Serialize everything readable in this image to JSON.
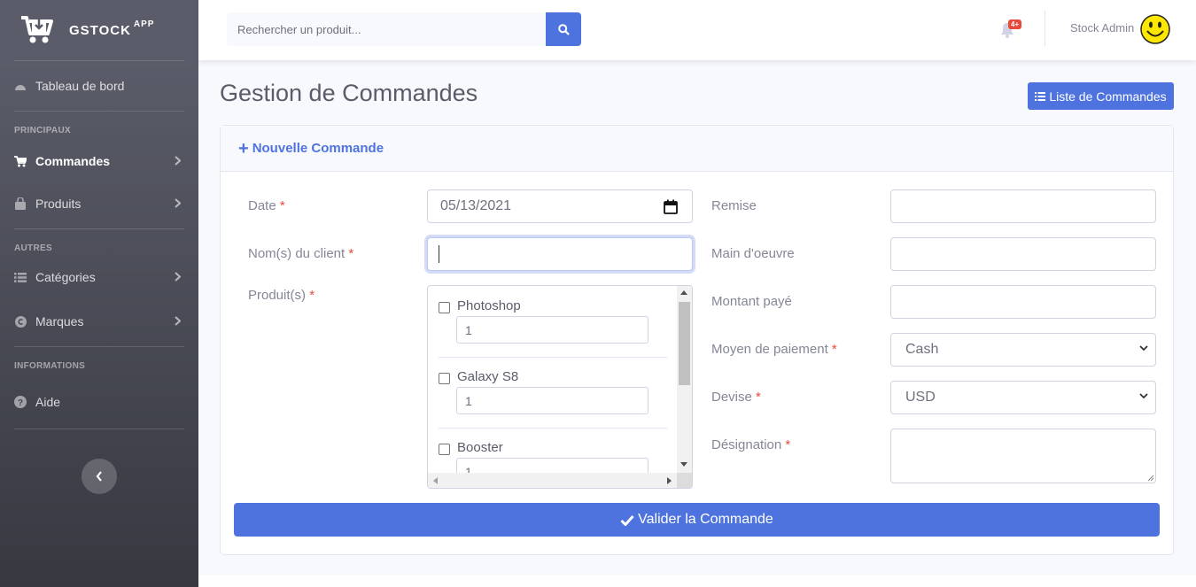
{
  "brand": {
    "name": "GSTOCK",
    "sup": "APP"
  },
  "sidebar": {
    "dashboard": "Tableau de bord",
    "heading_main": "PRINCIPAUX",
    "commandes": "Commandes",
    "produits": "Produits",
    "heading_other": "AUTRES",
    "categories": "Catégories",
    "marques": "Marques",
    "heading_info": "INFORMATIONS",
    "aide": "Aide"
  },
  "topbar": {
    "search_placeholder": "Rechercher un produit...",
    "notification_count": "4+",
    "user_name": "Stock Admin"
  },
  "page": {
    "title": "Gestion de Commandes",
    "list_button": "Liste de Commandes"
  },
  "card": {
    "header": "Nouvelle Commande",
    "date_label": "Date",
    "date_value": "05/13/2021",
    "client_label": "Nom(s) du client",
    "client_value": "",
    "products_label": "Produit(s)",
    "products": [
      {
        "name": "Photoshop",
        "qty": "1"
      },
      {
        "name": "Galaxy S8",
        "qty": "1"
      },
      {
        "name": "Booster",
        "qty": "1"
      }
    ],
    "remise_label": "Remise",
    "remise_value": "",
    "main_oeuvre_label": "Main d'oeuvre",
    "main_oeuvre_value": "",
    "montant_label": "Montant payé",
    "montant_value": "",
    "paiement_label": "Moyen de paiement",
    "paiement_value": "Cash",
    "devise_label": "Devise",
    "devise_value": "USD",
    "designation_label": "Désignation",
    "designation_value": "",
    "required_mark": "*",
    "submit": "Valider la Commande"
  },
  "colors": {
    "primary": "#4e73df",
    "danger": "#e74a3b",
    "sidebar_top": "#5a5c69",
    "sidebar_bottom": "#373840"
  }
}
